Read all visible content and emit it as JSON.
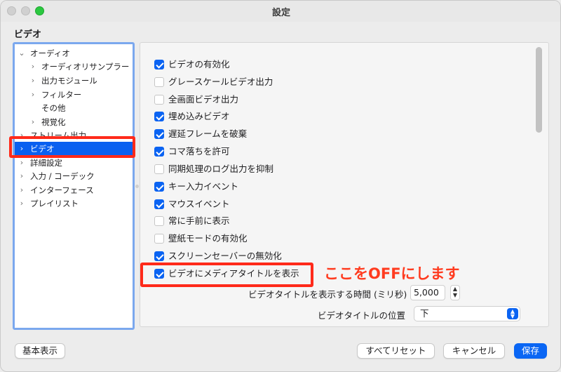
{
  "window": {
    "title": "設定"
  },
  "section_title": "ビデオ",
  "sidebar": {
    "items": [
      {
        "label": "オーディオ",
        "chevron": "down",
        "level": 0
      },
      {
        "label": "オーディオリサンプラー",
        "chevron": "right",
        "level": 1
      },
      {
        "label": "出力モジュール",
        "chevron": "right",
        "level": 1
      },
      {
        "label": "フィルター",
        "chevron": "right",
        "level": 1
      },
      {
        "label": "その他",
        "chevron": "",
        "level": 1
      },
      {
        "label": "視覚化",
        "chevron": "right",
        "level": 1
      },
      {
        "label": "ストリーム出力",
        "chevron": "right",
        "level": 0
      },
      {
        "label": "ビデオ",
        "chevron": "right",
        "level": 0,
        "selected": true
      },
      {
        "label": "詳細設定",
        "chevron": "right",
        "level": 0
      },
      {
        "label": "入力 / コーデック",
        "chevron": "right",
        "level": 0
      },
      {
        "label": "インターフェース",
        "chevron": "right",
        "level": 0
      },
      {
        "label": "プレイリスト",
        "chevron": "right",
        "level": 0
      }
    ]
  },
  "options": [
    {
      "label": "ビデオの有効化",
      "checked": true
    },
    {
      "label": "グレースケールビデオ出力",
      "checked": false
    },
    {
      "label": "全画面ビデオ出力",
      "checked": false
    },
    {
      "label": "埋め込みビデオ",
      "checked": true
    },
    {
      "label": "遅延フレームを破棄",
      "checked": true
    },
    {
      "label": "コマ落ちを許可",
      "checked": true
    },
    {
      "label": "同期処理のログ出力を抑制",
      "checked": false
    },
    {
      "label": "キー入力イベント",
      "checked": true
    },
    {
      "label": "マウスイベント",
      "checked": true
    },
    {
      "label": "常に手前に表示",
      "checked": false
    },
    {
      "label": "壁紙モードの有効化",
      "checked": false
    },
    {
      "label": "スクリーンセーバーの無効化",
      "checked": true
    },
    {
      "label": "ビデオにメディアタイトルを表示",
      "checked": true
    }
  ],
  "annotation": "ここをOFFにします",
  "title_duration": {
    "label": "ビデオタイトルを表示する時間 (ミリ秒)",
    "value": "5,000"
  },
  "title_position": {
    "label": "ビデオタイトルの位置",
    "value": "下"
  },
  "buttons": {
    "basic_view": "基本表示",
    "reset_all": "すべてリセット",
    "cancel": "キャンセル",
    "save": "保存"
  },
  "colors": {
    "accent": "#0a63f2",
    "highlight": "#ff2a1a",
    "annotation_text": "#ff3b1f"
  }
}
